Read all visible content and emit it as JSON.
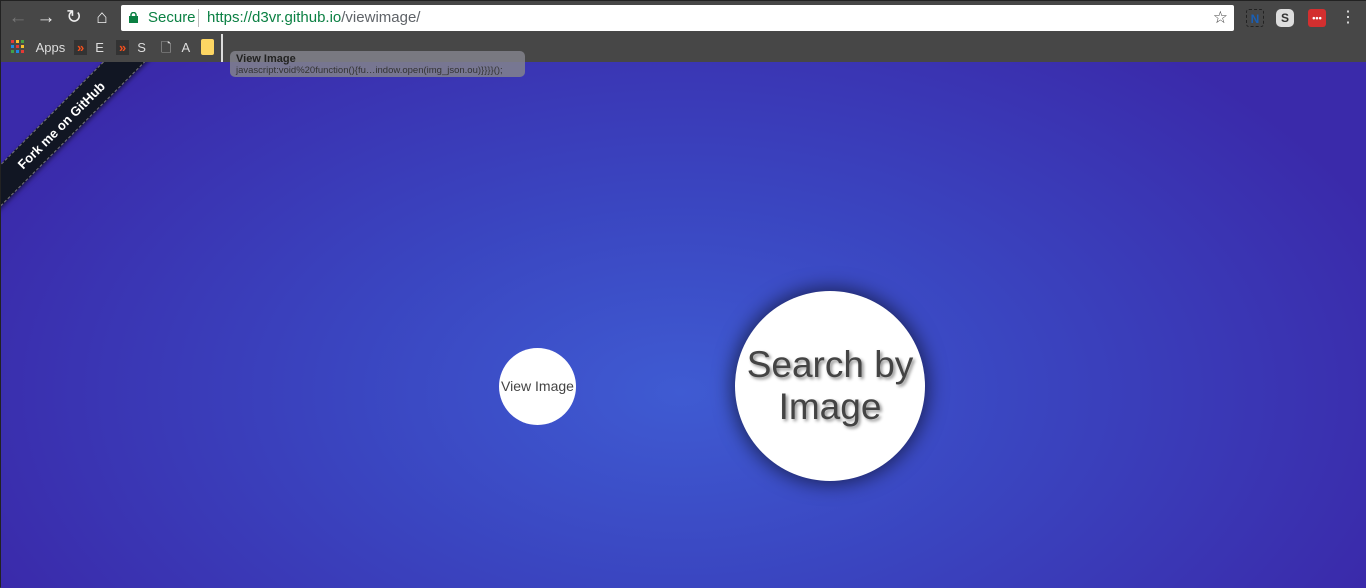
{
  "browser": {
    "secure_label": "Secure",
    "url_host": "https://d3vr.github.io",
    "url_path": "/viewimage/",
    "extensions": [
      {
        "icon": "n-extension-icon",
        "label": "N"
      },
      {
        "icon": "s-extension-icon",
        "label": "S"
      },
      {
        "icon": "lastpass-icon",
        "label": "•••"
      }
    ]
  },
  "bookmarks": [
    {
      "icon": "apps-grid-icon",
      "label": "Apps"
    },
    {
      "icon": "bookmark-chevron-icon",
      "label": "E"
    },
    {
      "icon": "bookmark-chevron-icon",
      "label": "S"
    },
    {
      "icon": "page-icon",
      "label": "A"
    },
    {
      "icon": "note-icon",
      "label": ""
    }
  ],
  "tooltip": {
    "title": "View Image",
    "url": "javascript:void%20function(){fu…indow.open(img_json.ou)}}}}();"
  },
  "page": {
    "ribbon": "Fork me on GitHub",
    "small_circle": "View Image",
    "big_circle": "Search by Image"
  },
  "colors": {
    "accent_secure": "#0b8043",
    "background_center": "#3f5bd2",
    "background_edge": "#3a2aaa"
  }
}
